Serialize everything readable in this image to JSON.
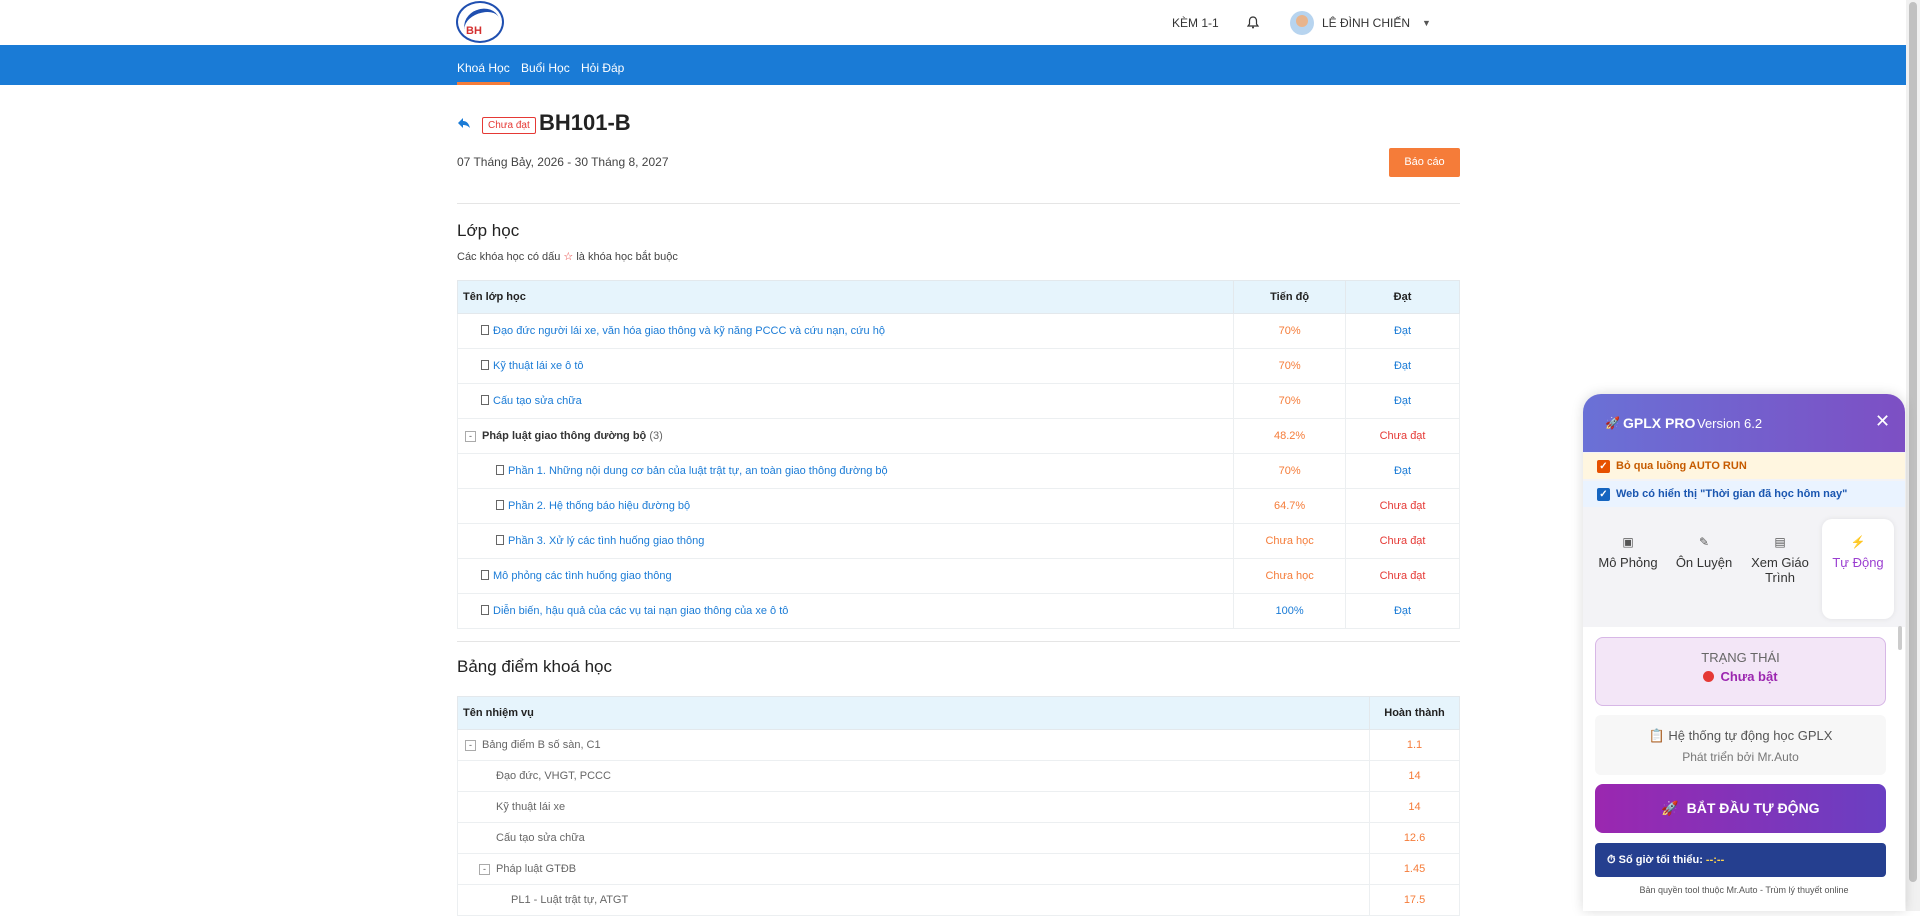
{
  "header": {
    "logo_text": "BH",
    "kem_label": "KÈM 1-1",
    "user_name": "LÊ ĐÌNH CHIẾN"
  },
  "nav": {
    "items": [
      {
        "label": "Khoá Học",
        "active": true
      },
      {
        "label": "Buổi Học",
        "active": false
      },
      {
        "label": "Hỏi Đáp",
        "active": false
      }
    ]
  },
  "course": {
    "status_badge": "Chưa đạt",
    "code": "BH101-B",
    "date_range": "07 Tháng Bảy, 2026 - 30 Tháng 8, 2027",
    "report_button": "Báo cáo"
  },
  "classes": {
    "title": "Lớp học",
    "hint_before": "Các khóa học có dấu",
    "hint_star": "☆",
    "hint_after": "là khóa học bắt buộc",
    "columns": [
      "Tên lớp học",
      "Tiến độ",
      "Đạt"
    ],
    "rows": [
      {
        "name": "Đạo đức người lái xe, văn hóa giao thông và kỹ năng PCCC và cứu nạn, cứu hộ",
        "progress": "70%",
        "result": "Đạt"
      },
      {
        "name": "Kỹ thuật lái xe ô tô",
        "progress": "70%",
        "result": "Đạt"
      },
      {
        "name": "Cấu tạo sửa chữa",
        "progress": "70%",
        "result": "Đạt"
      },
      {
        "name": "Pháp luật giao thông đường bộ",
        "count": "(3)",
        "progress": "48.2%",
        "result": "Chưa đạt"
      },
      {
        "name": "Phần 1. Những nội dung cơ bản của luật trật tự, an toàn giao thông đường bộ",
        "progress": "70%",
        "result": "Đạt"
      },
      {
        "name": "Phần 2. Hệ thống báo hiệu đường bộ",
        "progress": "64.7%",
        "result": "Chưa đạt"
      },
      {
        "name": "Phần 3. Xử lý các tình huống giao thông",
        "progress": "Chưa học",
        "result": "Chưa đạt"
      },
      {
        "name": "Mô phỏng các tình huống giao thông",
        "progress": "Chưa học",
        "result": "Chưa đạt"
      },
      {
        "name": "Diễn biến, hậu quả của các vụ tai nạn giao thông của xe ô tô",
        "progress": "100%",
        "result": "Đạt"
      }
    ]
  },
  "scores": {
    "title": "Bảng điểm khoá học",
    "columns": [
      "Tên nhiệm vụ",
      "Hoàn thành"
    ],
    "rows": [
      {
        "name": "Bảng điểm B số sàn, C1",
        "value": "1.1"
      },
      {
        "name": "Đạo đức, VHGT, PCCC",
        "value": "14"
      },
      {
        "name": "Kỹ thuật lái xe",
        "value": "14"
      },
      {
        "name": "Cấu tạo sửa chữa",
        "value": "12.6"
      },
      {
        "name": "Pháp luật GTĐB",
        "value": "1.45"
      },
      {
        "name": "PL1 - Luật trật tự, ATGT",
        "value": "17.5"
      }
    ]
  },
  "extension": {
    "title": "GPLX PRO",
    "version": "Version 6.2",
    "option1": "Bỏ qua luồng AUTO RUN",
    "option2": "Web có hiển thị \"Thời gian đã học hôm nay\"",
    "tabs": [
      {
        "label": "Mô Phỏng",
        "icon": "monitor-icon"
      },
      {
        "label": "Ôn Luyện",
        "icon": "pencil-icon"
      },
      {
        "label": "Xem Giáo Trình",
        "icon": "book-icon"
      },
      {
        "label": "Tự Động",
        "icon": "lightning-icon"
      }
    ],
    "status_label": "TRẠNG THÁI",
    "status_value": "Chưa bật",
    "info_title": "Hệ thống tự động học GPLX",
    "info_sub": "Phát triển bởi Mr.Auto",
    "start_button": "BẮT ĐẦU TỰ ĐỘNG",
    "min_hours_label": "Số giờ tối thiểu:",
    "min_hours_value": "--:--",
    "footer": "Bản quyền tool thuộc Mr.Auto - Trùm lý thuyết online"
  }
}
